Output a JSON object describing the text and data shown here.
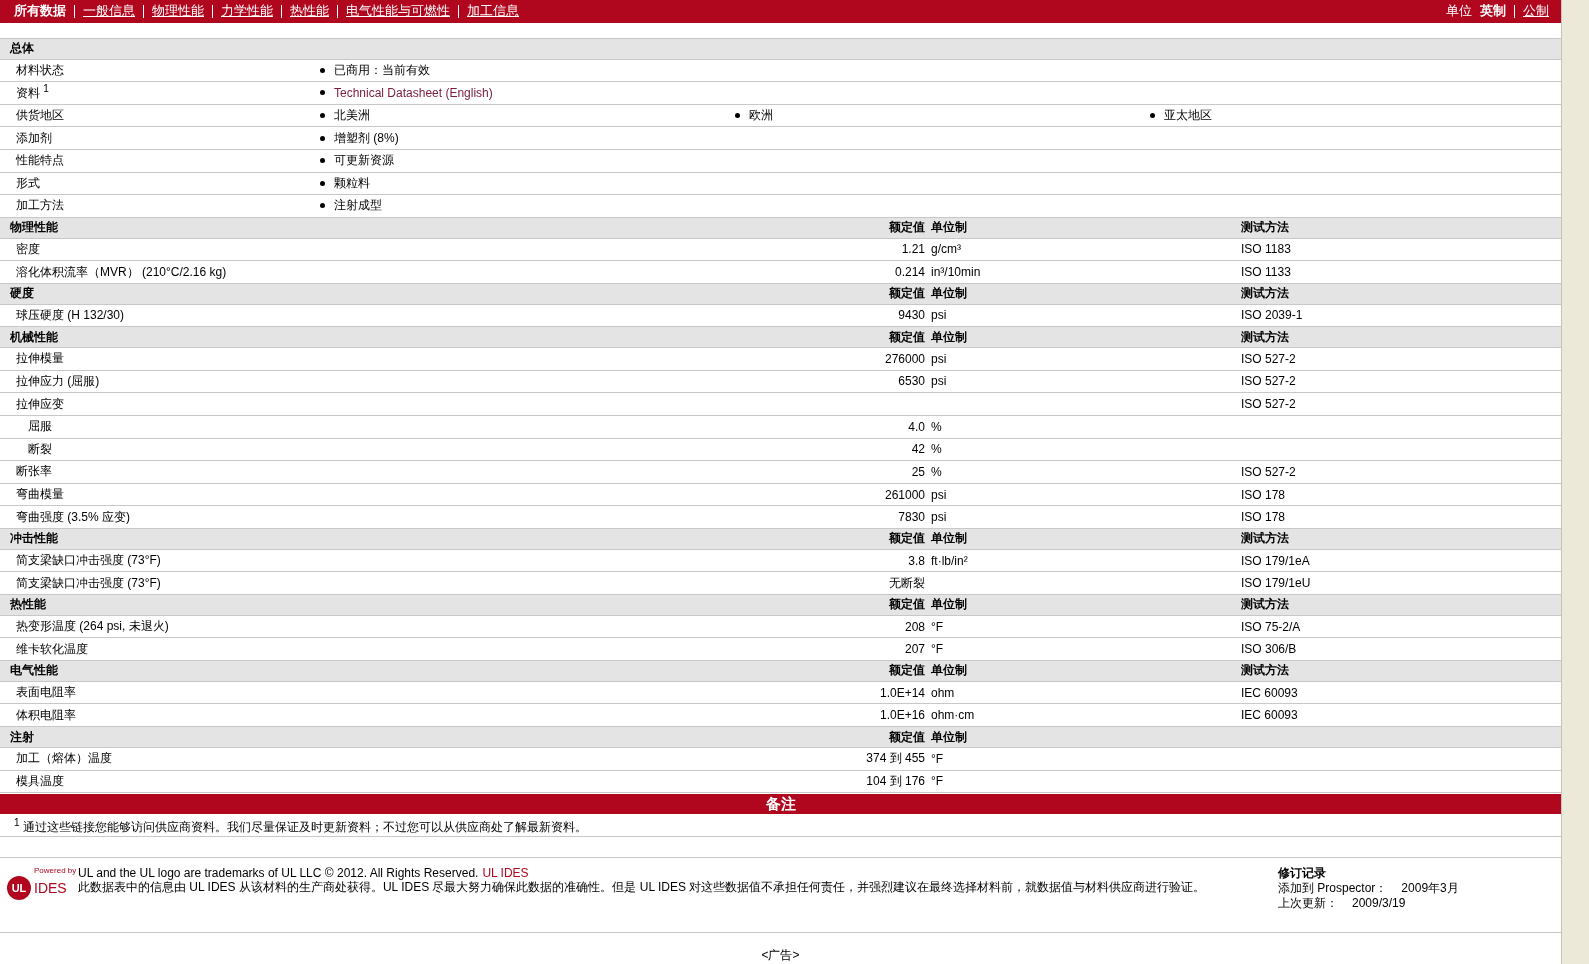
{
  "nav": {
    "items": [
      {
        "label": "所有数据",
        "selected": true
      },
      {
        "label": "一般信息",
        "selected": false
      },
      {
        "label": "物理性能",
        "selected": false
      },
      {
        "label": "力学性能",
        "selected": false
      },
      {
        "label": "热性能",
        "selected": false
      },
      {
        "label": "电气性能与可燃性",
        "selected": false
      },
      {
        "label": "加工信息",
        "selected": false
      }
    ],
    "units_label": "单位",
    "units": [
      {
        "label": "英制",
        "selected": true
      },
      {
        "label": "公制",
        "selected": false
      }
    ]
  },
  "general": {
    "title": "总体",
    "rows": [
      {
        "label": "材料状态",
        "values": [
          {
            "kind": "text",
            "text": "已商用：当前有效"
          }
        ]
      },
      {
        "label": "资料 $^{1}$",
        "values": [
          {
            "kind": "link",
            "text": "Technical Datasheet (English)"
          }
        ]
      },
      {
        "label": "供货地区",
        "values": [
          {
            "kind": "text",
            "text": "北美洲"
          },
          {
            "kind": "text",
            "text": "欧洲"
          },
          {
            "kind": "text",
            "text": "亚太地区"
          }
        ]
      },
      {
        "label": "添加剂",
        "values": [
          {
            "kind": "text",
            "text": "增塑剂  (8%)"
          }
        ]
      },
      {
        "label": "性能特点",
        "values": [
          {
            "kind": "text",
            "text": "可更新资源"
          }
        ]
      },
      {
        "label": "形式",
        "values": [
          {
            "kind": "text",
            "text": "颗粒料"
          }
        ]
      },
      {
        "label": "加工方法",
        "values": [
          {
            "kind": "text",
            "text": "注射成型"
          }
        ]
      }
    ]
  },
  "sections": [
    {
      "title": "物理性能",
      "value_header": "额定值",
      "unit_header": "单位制",
      "method_header": "测试方法",
      "rows": [
        {
          "label": "密度",
          "value": "1.21",
          "unit": "g/cm³",
          "method": "ISO 1183"
        },
        {
          "label": "溶化体积流率（MVR）  (210°C/2.16 kg)",
          "value": "0.214",
          "unit": "in³/10min",
          "method": "ISO 1133"
        }
      ]
    },
    {
      "title": "硬度",
      "value_header": "额定值",
      "unit_header": "单位制",
      "method_header": "测试方法",
      "rows": [
        {
          "label": "球压硬度  (H 132/30)",
          "value": "9430",
          "unit": "psi",
          "method": "ISO 2039-1"
        }
      ]
    },
    {
      "title": "机械性能",
      "value_header": "额定值",
      "unit_header": "单位制",
      "method_header": "测试方法",
      "rows": [
        {
          "label": "拉伸模量",
          "value": "276000",
          "unit": "psi",
          "method": "ISO 527-2"
        },
        {
          "label": "拉伸应力  (屈服)",
          "value": "6530",
          "unit": "psi",
          "method": "ISO 527-2"
        },
        {
          "label": "拉伸应变",
          "method": "ISO 527-2",
          "children": [
            {
              "label": "屈服",
              "value": "4.0",
              "unit": "%"
            },
            {
              "label": "断裂",
              "value": "42",
              "unit": "%"
            }
          ]
        },
        {
          "label": "断张率",
          "value": "25",
          "unit": "%",
          "method": "ISO 527-2"
        },
        {
          "label": "弯曲模量",
          "value": "261000",
          "unit": "psi",
          "method": "ISO 178"
        },
        {
          "label": "弯曲强度  (3.5% 应变)",
          "value": "7830",
          "unit": "psi",
          "method": "ISO 178"
        }
      ]
    },
    {
      "title": "冲击性能",
      "value_header": "额定值",
      "unit_header": "单位制",
      "method_header": "测试方法",
      "rows": [
        {
          "label": "简支梁缺口冲击强度  (73°F)",
          "value": "3.8",
          "unit": "ft·lb/in²",
          "method": "ISO 179/1eA"
        },
        {
          "label": "简支梁缺口冲击强度  (73°F)",
          "value": "无断裂",
          "method": "ISO 179/1eU"
        }
      ]
    },
    {
      "title": "热性能",
      "value_header": "额定值",
      "unit_header": "单位制",
      "method_header": "测试方法",
      "rows": [
        {
          "label": "热变形温度  (264 psi, 未退火)",
          "value": "208",
          "unit": "°F",
          "method": "ISO 75-2/A"
        },
        {
          "label": "维卡软化温度",
          "value": "207",
          "unit": "°F",
          "method": "ISO 306/B"
        }
      ]
    },
    {
      "title": "电气性能",
      "value_header": "额定值",
      "unit_header": "单位制",
      "method_header": "测试方法",
      "rows": [
        {
          "label": "表面电阻率",
          "value": "1.0E+14",
          "unit": "ohm",
          "method": "IEC 60093"
        },
        {
          "label": "体积电阻率",
          "value": "1.0E+16",
          "unit": "ohm·cm",
          "method": "IEC 60093"
        }
      ]
    },
    {
      "title": "注射",
      "value_header": "额定值",
      "unit_header": "单位制",
      "rows": [
        {
          "label": "加工（熔体）温度",
          "value": "374 到  455",
          "unit": "°F"
        },
        {
          "label": "模具温度",
          "value": "104 到  176",
          "unit": "°F"
        }
      ]
    }
  ],
  "notes": {
    "title": "备注",
    "items": [
      "$^{1}$ 通过这些链接您能够访问供应商资料。我们尽量保证及时更新资料；不过您可以从供应商处了解最新资料。"
    ]
  },
  "footer": {
    "logo": {
      "caption": "Powered by",
      "mark": "UL",
      "name": "IDES"
    },
    "trademark": "UL and the UL logo are trademarks of UL LLC © 2012. All Rights Reserved.",
    "trademark_link": "UL IDES",
    "disclaimer": "此数据表中的信息由  UL IDES 从该材料的生产商处获得。UL IDES 尽最大努力确保此数据的准确性。但是  UL IDES 对这些数据值不承担任何责任，并强烈建议在最终选择材料前，就数据值与材料供应商进行验证。",
    "revision": {
      "title": "修订记录",
      "rows": [
        {
          "label": "添加到  Prospector：",
          "value": "2009年3月"
        },
        {
          "label": "上次更新：",
          "value": "2009/3/19"
        }
      ]
    }
  },
  "ad": "<广告>"
}
